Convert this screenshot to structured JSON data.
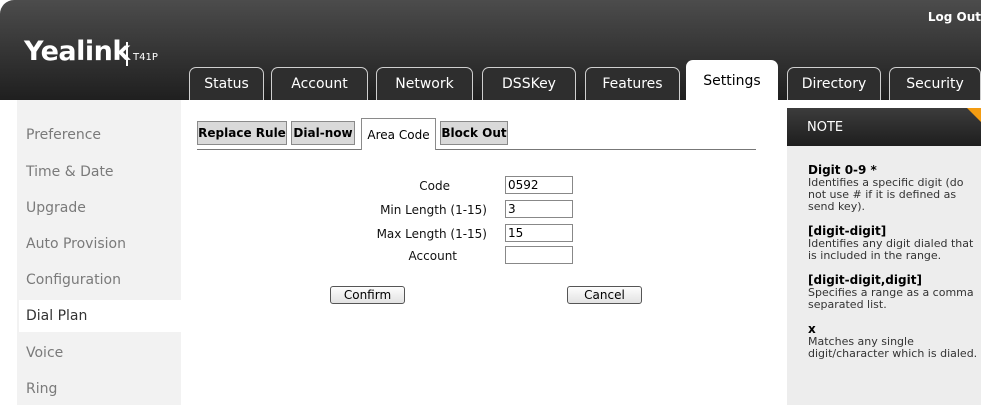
{
  "header": {
    "logo": "Yealink",
    "model": "T41P",
    "logout": "Log Out",
    "tabs": [
      {
        "label": "Status"
      },
      {
        "label": "Account"
      },
      {
        "label": "Network"
      },
      {
        "label": "DSSKey"
      },
      {
        "label": "Features"
      },
      {
        "label": "Settings",
        "active": true
      },
      {
        "label": "Directory"
      },
      {
        "label": "Security"
      }
    ]
  },
  "sidebar": {
    "items": [
      {
        "label": "Preference"
      },
      {
        "label": "Time & Date"
      },
      {
        "label": "Upgrade"
      },
      {
        "label": "Auto Provision"
      },
      {
        "label": "Configuration"
      },
      {
        "label": "Dial Plan",
        "active": true
      },
      {
        "label": "Voice"
      },
      {
        "label": "Ring"
      }
    ]
  },
  "subtabs": [
    {
      "label": "Replace Rule"
    },
    {
      "label": "Dial-now"
    },
    {
      "label": "Area Code",
      "active": true
    },
    {
      "label": "Block Out"
    }
  ],
  "form": {
    "code": {
      "label": "Code",
      "value": "0592"
    },
    "min_length": {
      "label": "Min Length (1-15)",
      "value": "3"
    },
    "max_length": {
      "label": "Max Length (1-15)",
      "value": "15"
    },
    "account": {
      "label": "Account",
      "value": ""
    },
    "confirm_label": "Confirm",
    "cancel_label": "Cancel"
  },
  "note": {
    "title": "NOTE",
    "entries": [
      {
        "term": "Digit 0-9 *",
        "desc": "Identifies a specific digit (do not use # if it is defined as send key)."
      },
      {
        "term": "[digit-digit]",
        "desc": "Identifies any digit dialed that is included in the range."
      },
      {
        "term": "[digit-digit,digit]",
        "desc": "Specifies a range as a comma separated list."
      },
      {
        "term": "x",
        "desc": "Matches any single digit/character which is dialed."
      }
    ]
  },
  "colors": {
    "header_dark": "#2e2e2e",
    "sidebar_bg": "#f2f2f2",
    "note_bg": "#ededed",
    "note_corner": "#f39c12"
  }
}
